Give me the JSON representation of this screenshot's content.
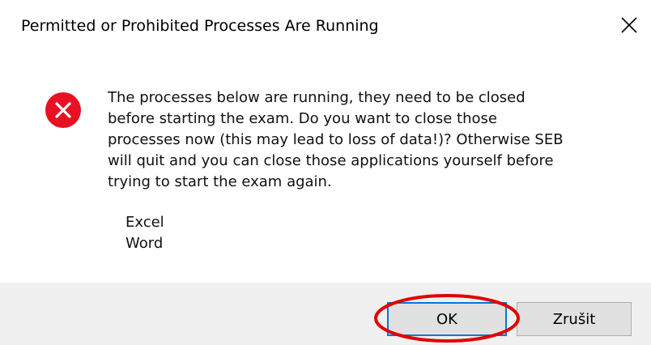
{
  "dialog": {
    "title": "Permitted or Prohibited Processes Are Running",
    "close_icon": "close-icon",
    "status_icon": "error-icon",
    "message_lines": [
      "The processes below are running, they need to be closed",
      "before starting the exam. Do you want to close those",
      "processes now (this may lead to loss of data!)? Otherwise SEB",
      "will quit and you can close those applications yourself before",
      "trying to start the exam again."
    ],
    "processes": [
      "Excel",
      "Word"
    ],
    "buttons": {
      "ok_label": "OK",
      "cancel_label": "Zrušit"
    }
  },
  "colors": {
    "error_red": "#e81123",
    "focus_blue": "#0078d7",
    "annotation_red": "#e00000",
    "footer_bg": "#f0f0f0",
    "button_bg": "#e1e1e1"
  },
  "annotation": {
    "shape": "ellipse",
    "target": "ok-button"
  }
}
